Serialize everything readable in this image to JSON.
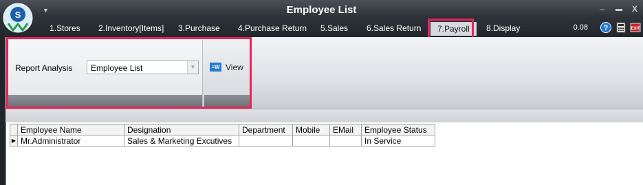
{
  "window": {
    "title": "Employee List",
    "minimize_icon": "minimize-icon",
    "maximize_icon": "maximize-icon",
    "close_label": "X"
  },
  "menu": {
    "items": [
      {
        "label": "1.Stores"
      },
      {
        "label": "2.Inventory[Items]"
      },
      {
        "label": "3.Purchase"
      },
      {
        "label": "4.Purchase Return"
      },
      {
        "label": "5.Sales"
      },
      {
        "label": "6.Sales Return"
      },
      {
        "label": "7.Payroll",
        "active": true
      },
      {
        "label": "8.Display"
      }
    ],
    "version": "0.08"
  },
  "ribbon": {
    "report_label": "Report Analysis",
    "report_value": "Employee List",
    "view_label": "View",
    "view_icon_text": "≡W"
  },
  "grid": {
    "columns": [
      "Employee Name",
      "Designation",
      "Department",
      "Mobile",
      "EMail",
      "Employee Status"
    ],
    "rows": [
      [
        "Mr.Administrator",
        "Sales & Marketing Excutives",
        "",
        "",
        "",
        "In Service"
      ]
    ],
    "row_indicator": "▶"
  },
  "colors": {
    "highlight": "#e8235a",
    "titlebar": "#2e3339",
    "accent_blue": "#1f7bd1"
  }
}
